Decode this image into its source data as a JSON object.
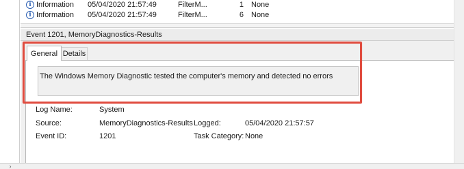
{
  "event_list": {
    "rows": [
      {
        "level": "Information",
        "date": "05/04/2020 21:57:49",
        "source": "FilterM...",
        "event_id": "1",
        "task": "None"
      },
      {
        "level": "Information",
        "date": "05/04/2020 21:57:49",
        "source": "FilterM...",
        "event_id": "6",
        "task": "None"
      }
    ]
  },
  "detail": {
    "title": "Event 1201, MemoryDiagnostics-Results",
    "tabs": [
      "General",
      "Details"
    ],
    "active_tab": "General",
    "description": "The Windows Memory Diagnostic tested the computer's memory and detected no errors",
    "properties": {
      "log_name_label": "Log Name:",
      "log_name": "System",
      "source_label": "Source:",
      "source": "MemoryDiagnostics-Results",
      "logged_label": "Logged:",
      "logged": "05/04/2020 21:57:57",
      "event_id_label": "Event ID:",
      "event_id": "1201",
      "task_category_label": "Task Category:",
      "task_category": "None"
    }
  },
  "icons": {
    "row_icon": "information-icon",
    "scroll_right": "chevron-right-icon"
  },
  "colors": {
    "highlight": "#e04c3f",
    "info_icon": "#2b5fb3"
  }
}
